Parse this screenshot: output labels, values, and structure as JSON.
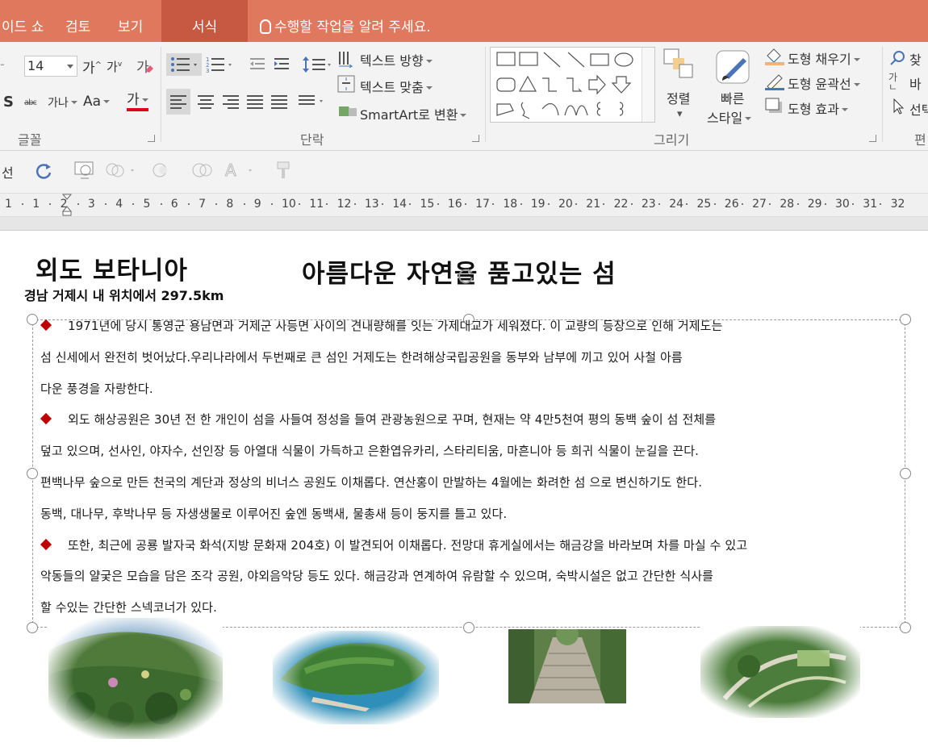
{
  "tabs": [
    {
      "label": "이드 쇼",
      "active": false
    },
    {
      "label": "검토",
      "active": false
    },
    {
      "label": "보기",
      "active": false
    },
    {
      "label": "서식",
      "active": true
    }
  ],
  "tell_me": "수행할 작업을 알려 주세요.",
  "ribbon": {
    "font": {
      "size": "14",
      "grow_label": "가",
      "shrink_label": "가",
      "clear_label": "가",
      "spacing_label": "가나",
      "case_label": "Aa",
      "color_label": "가",
      "group_label": "글꼴"
    },
    "paragraph": {
      "text_direction": "텍스트 방향",
      "align_text": "텍스트 맞춤",
      "smartart": "SmartArt로 변환",
      "group_label": "단락"
    },
    "drawing": {
      "arrange": "정렬",
      "quick_styles_1": "빠른",
      "quick_styles_2": "스타일",
      "shape_fill": "도형 채우기",
      "shape_outline": "도형 윤곽선",
      "shape_effects": "도형 효과",
      "group_label": "그리기"
    },
    "editing": {
      "find": "찾",
      "replace": "바",
      "select": "선택",
      "group_label": "편"
    }
  },
  "quick_bar": {
    "left_label": "선"
  },
  "ruler": {
    "numbers": [
      "1",
      "1",
      "2",
      "3",
      "4",
      "5",
      "6",
      "7",
      "8",
      "9",
      "10",
      "11",
      "12",
      "13",
      "14",
      "15",
      "16",
      "17",
      "18",
      "19",
      "20",
      "21",
      "22",
      "23",
      "24",
      "25",
      "26",
      "27",
      "28",
      "29",
      "30",
      "31",
      "32"
    ]
  },
  "slide": {
    "title_left": "외도 보타니아",
    "title_right": "아름다운 자연을 품고있는 섬",
    "subtitle": "경남 거제시 내 위치에서 297.5km",
    "lines": [
      {
        "bullet": true,
        "text": "1971년에 당시 통영군 용남면과 거제군 사등면 사이의 견내량해를 잇는 가제대교가 세워졌다. 이 교량의 등장으로 인해 거제도는"
      },
      {
        "bullet": false,
        "text": "섬 신세에서 완전히 벗어났다.우리나라에서 두번째로 큰 섬인 거제도는 한려해상국립공원을 동부와 남부에 끼고 있어 사철 아름"
      },
      {
        "bullet": false,
        "text": "다운 풍경을 자랑한다."
      },
      {
        "bullet": true,
        "text": "외도 해상공원은 30년 전 한 개인이 섬을 사들여 정성을 들여 관광농원으로 꾸며, 현재는 약 4만5천여 평의 동백 숲이 섬 전체를"
      },
      {
        "bullet": false,
        "text": "덮고 있으며, 선사인, 야자수, 선인장 등 아열대 식물이 가득하고 은환엽유카리, 스타리티움, 마흔니아 등 희귀 식물이 눈길을 끈다."
      },
      {
        "bullet": false,
        "text": "편백나무 숲으로 만든 천국의 계단과 정상의 비너스 공원도 이채롭다. 연산홍이 만발하는 4월에는 화려한 섬 으로 변신하기도 한다."
      },
      {
        "bullet": false,
        "text": "동백, 대나무, 후박나무 등 자생생물로 이루어진  숲엔 동백새, 물총새 등이 둥지를 틀고 있다."
      },
      {
        "bullet": true,
        "text": "또한, 최근에 공룡 발자국 화석(지방 문화재 204호) 이 발견되어 이채롭다. 전망대 휴게실에서는 해금강을 바라보며 차를 마실 수 있고"
      },
      {
        "bullet": false,
        "text": "악동들의 얄궂은 모습을 담은 조각 공원, 야외음악당 등도 있다. 해금강과 연계하여 유람할 수 있으며, 숙박시설은 없고 간단한 식사를"
      },
      {
        "bullet": false,
        "text": "할 수있는 간단한 스넥코너가 있다."
      }
    ]
  },
  "colors": {
    "tab_bar": "#e0785e",
    "active_tab": "#c75842",
    "ribbon_bg": "#f3f3f3",
    "bullet": "#c00000"
  }
}
